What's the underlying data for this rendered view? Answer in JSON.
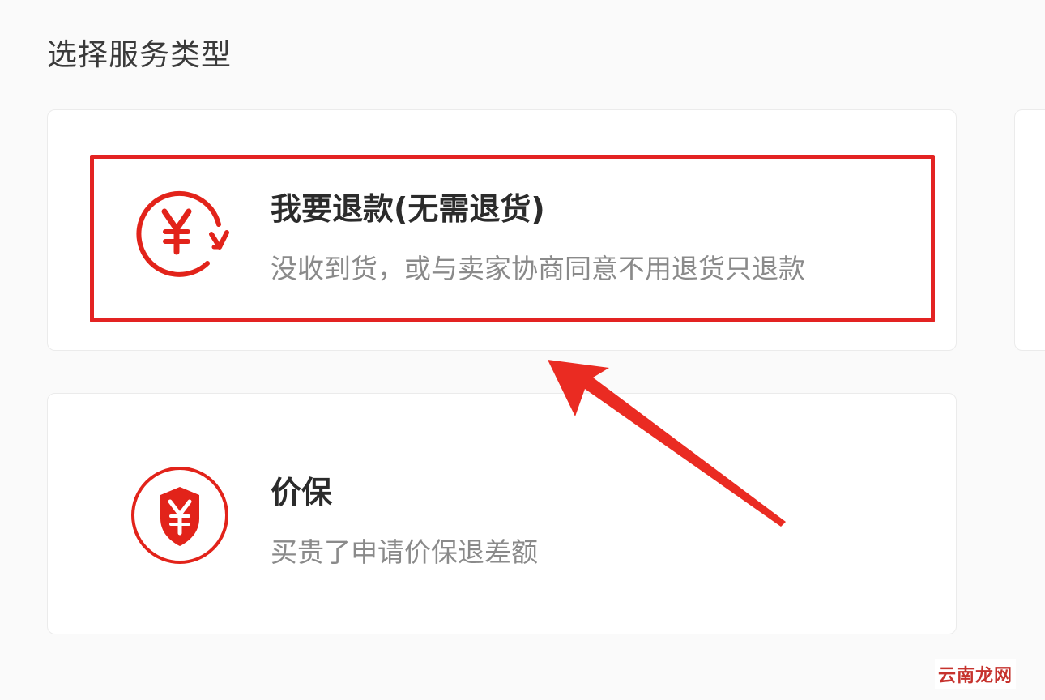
{
  "page": {
    "title": "选择服务类型"
  },
  "options": [
    {
      "title": "我要退款(无需退货)",
      "description": "没收到货，或与卖家协商同意不用退货只退款",
      "icon": "refund-yuan-icon"
    },
    {
      "title": "价保",
      "description": "买贵了申请价保退差额",
      "icon": "price-protection-shield-icon"
    }
  ],
  "annotation": {
    "highlight_color": "#e32322",
    "arrow_color": "#ea2b22"
  },
  "watermark": {
    "text": "云南龙网"
  }
}
